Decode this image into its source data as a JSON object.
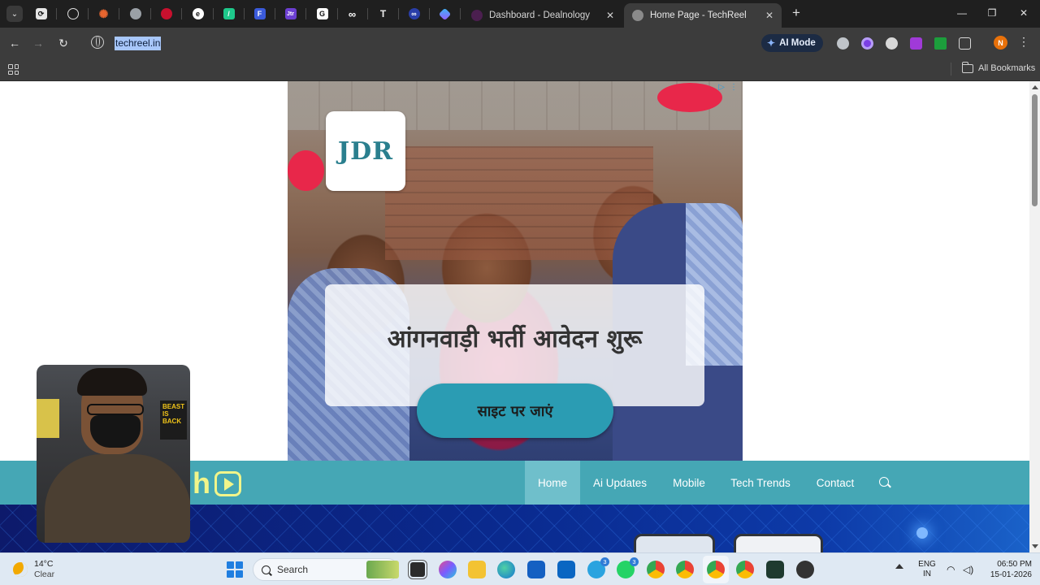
{
  "browser": {
    "tabs": [
      {
        "title": "Dashboard - Dealnology",
        "active": false
      },
      {
        "title": "Home Page - TechReel",
        "active": true
      }
    ],
    "url": "techreel.in",
    "ai_mode_label": "AI Mode",
    "profile_initial": "N",
    "all_bookmarks_label": "All Bookmarks"
  },
  "ad": {
    "logo_text": "JDR",
    "headline": "आंगनवाड़ी भर्ती आवेदन शुरू",
    "cta": "साइट पर जाएं"
  },
  "webcam_poster_text": "BEAST IS BACK",
  "site": {
    "nav": [
      {
        "label": "Home",
        "active": true
      },
      {
        "label": "Ai Updates",
        "active": false
      },
      {
        "label": "Mobile",
        "active": false
      },
      {
        "label": "Tech Trends",
        "active": false
      },
      {
        "label": "Contact",
        "active": false
      }
    ]
  },
  "taskbar": {
    "weather_temp": "14°C",
    "weather_desc": "Clear",
    "search_placeholder": "Search",
    "badges": {
      "telegram": "3",
      "whatsapp": "3"
    },
    "language": "ENG",
    "region": "IN",
    "time": "06:50 PM",
    "date": "15-01-2026"
  },
  "colors": {
    "site_nav": "#45a7b5",
    "site_nav_active": "#6fbfcb",
    "cta": "#2b9cb3",
    "logo_yellow": "#f1f58a",
    "url_highlight": "#a8c7fa"
  }
}
